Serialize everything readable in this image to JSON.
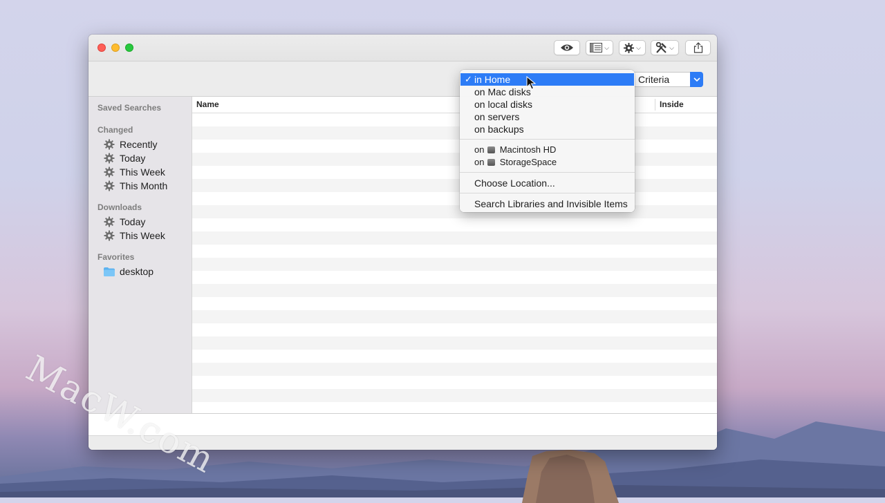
{
  "window": {
    "toolbar_icons": [
      "eye-icon",
      "list-view-icon",
      "gear-icon",
      "tools-icon",
      "share-icon"
    ]
  },
  "search_bar": {
    "criteria_label": "Criteria"
  },
  "sidebar": {
    "saved_searches": "Saved Searches",
    "sections": [
      {
        "heading": "Changed",
        "items": [
          "Recently",
          "Today",
          "This Week",
          "This Month"
        ]
      },
      {
        "heading": "Downloads",
        "items": [
          "Today",
          "This Week"
        ]
      },
      {
        "heading": "Favorites",
        "items": [
          "desktop"
        ]
      }
    ]
  },
  "results": {
    "columns": {
      "name": "Name",
      "inside": "Inside"
    }
  },
  "location_menu": {
    "items": [
      {
        "label": "in Home",
        "checked": true
      },
      {
        "label": "on Mac disks"
      },
      {
        "label": "on local disks"
      },
      {
        "label": "on servers"
      },
      {
        "label": "on backups"
      }
    ],
    "disks_prefix": "on",
    "disks": [
      "Macintosh HD",
      "StorageSpace"
    ],
    "choose_location": "Choose Location...",
    "search_libraries": "Search Libraries and Invisible Items"
  },
  "watermark": "MacW.com",
  "colors": {
    "accent": "#2d7cf6",
    "close": "#fe5f57",
    "minimize": "#febc2e",
    "maximize": "#28c840"
  }
}
